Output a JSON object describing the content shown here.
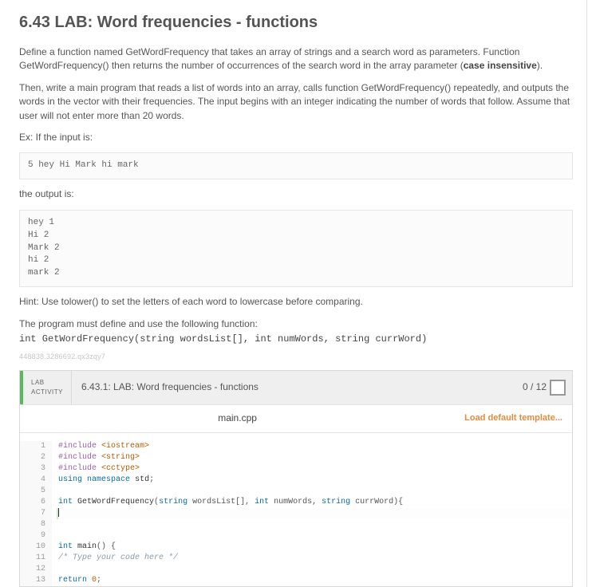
{
  "heading": "6.43 LAB: Word frequencies - functions",
  "para1_a": "Define a function named GetWordFrequency that takes an array of strings and a search word as parameters. Function GetWordFrequency() then returns the number of occurrences of the search word in the array parameter (",
  "para1_bold": "case insensitive",
  "para1_b": ").",
  "para2": "Then, write a main program that reads a list of words into an array, calls function GetWordFrequency() repeatedly, and outputs the words in the vector with their frequencies. The input begins with an integer indicating the number of words that follow. Assume that user will not enter more than 20 words.",
  "ex_label": "Ex: If the input is:",
  "input_code": "5 hey Hi Mark hi mark",
  "output_label": "the output is:",
  "output_code": "hey 1\nHi 2\nMark 2\nhi 2\nmark 2",
  "hint": "Hint: Use tolower() to set the letters of each word to lowercase before comparing.",
  "must_define": "The program must define and use the following function:",
  "signature": "int GetWordFrequency(string wordsList[], int numWords, string currWord)",
  "hash": "448838.3286692.qx3zqy7",
  "activity": {
    "badge_line1": "LAB",
    "badge_line2": "ACTIVITY",
    "title": "6.43.1: LAB: Word frequencies - functions",
    "score": "0 / 12"
  },
  "editor": {
    "filename": "main.cpp",
    "load_default": "Load default template...",
    "lines": [
      {
        "n": "1",
        "html": "<span class='tok-pre'>#include</span> <span class='tok-inc'>&lt;iostream&gt;</span>"
      },
      {
        "n": "2",
        "html": "<span class='tok-pre'>#include</span> <span class='tok-inc'>&lt;string&gt;</span>"
      },
      {
        "n": "3",
        "html": "<span class='tok-pre'>#include</span> <span class='tok-inc'>&lt;cctype&gt;</span>"
      },
      {
        "n": "4",
        "html": "<span class='tok-kw'>using</span> <span class='tok-kw'>namespace</span> <span class='tok-id'>std</span>;"
      },
      {
        "n": "5",
        "html": ""
      },
      {
        "n": "6",
        "html": "<span class='tok-type'>int</span> <span class='tok-id'>GetWordFrequency</span>(<span class='tok-type'>string</span> wordsList[], <span class='tok-type'>int</span> numWords, <span class='tok-type'>string</span> currWord){"
      },
      {
        "n": "7",
        "html": "   <span class='cursor-bar'></span>",
        "current": true
      },
      {
        "n": "8",
        "html": ""
      },
      {
        "n": "9",
        "html": ""
      },
      {
        "n": "10",
        "html": "<span class='tok-type'>int</span> <span class='tok-id'>main</span>() {"
      },
      {
        "n": "11",
        "html": "   <span class='tok-cmt'>/* Type your code here */</span>"
      },
      {
        "n": "12",
        "html": ""
      },
      {
        "n": "13",
        "html": "   <span class='tok-kw'>return</span> <span class='tok-num'>0</span>;"
      }
    ]
  }
}
